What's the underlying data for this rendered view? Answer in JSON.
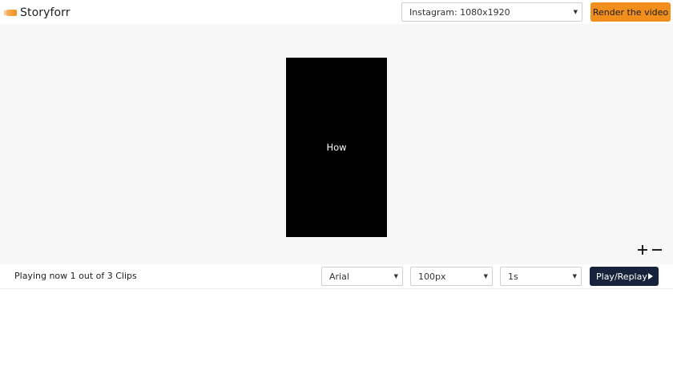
{
  "app": {
    "brand": "Storyforr",
    "accent_color": "#f28e1c",
    "dark_color": "#16233a"
  },
  "header": {
    "size_select": {
      "value": "Instagram: 1080x1920"
    },
    "render_button": "Render the video"
  },
  "stage": {
    "clip_text": "How",
    "canvas_color": "#000000",
    "background_color": "#f6f7f6"
  },
  "controls": {
    "status": "Playing now 1 out of 3 Clips",
    "font_select": {
      "value": "Arial"
    },
    "font_size_select": {
      "value": "100px"
    },
    "duration_select": {
      "value": "1s"
    },
    "play_button": "Play/Replay"
  },
  "icons": {
    "zoom_in": "plus-icon",
    "zoom_out": "minus-icon",
    "play": "play-icon",
    "dropdown": "caret-down-icon"
  }
}
